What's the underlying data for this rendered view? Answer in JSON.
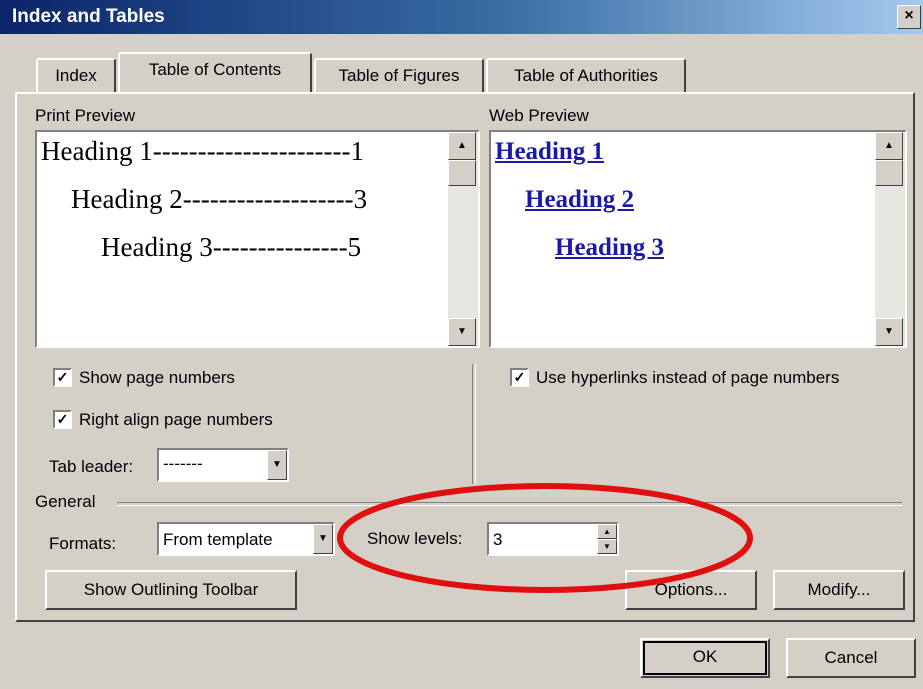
{
  "window": {
    "title": "Index and Tables",
    "close_glyph": "×"
  },
  "tabs": [
    {
      "label": "Index",
      "active": false
    },
    {
      "label": "Table of Contents",
      "active": true
    },
    {
      "label": "Table of Figures",
      "active": false
    },
    {
      "label": "Table of Authorities",
      "active": false
    }
  ],
  "print_preview": {
    "label": "Print Preview",
    "lines": [
      {
        "text": "Heading 1",
        "leader": "----------------------",
        "page": "1"
      },
      {
        "text": "Heading 2",
        "leader": "-------------------",
        "page": "3"
      },
      {
        "text": "Heading 3",
        "leader": " ---------------",
        "page": "5"
      }
    ]
  },
  "web_preview": {
    "label": "Web Preview",
    "links": [
      "Heading 1",
      "Heading 2",
      "Heading 3"
    ]
  },
  "options": {
    "show_page_numbers": {
      "label": "Show page numbers",
      "checked": true
    },
    "right_align": {
      "label": "Right align page numbers",
      "checked": true
    },
    "use_hyperlinks": {
      "label": "Use hyperlinks instead of page numbers",
      "checked": true
    },
    "tab_leader": {
      "label": "Tab leader:",
      "value": "-------"
    }
  },
  "general": {
    "label": "General",
    "formats_label": "Formats:",
    "formats_value": "From template",
    "show_levels_label": "Show levels:",
    "show_levels_value": "3"
  },
  "buttons": {
    "outlining": "Show Outlining Toolbar",
    "options": "Options...",
    "modify": "Modify...",
    "ok": "OK",
    "cancel": "Cancel"
  },
  "annotation": {
    "color": "#e01010"
  }
}
